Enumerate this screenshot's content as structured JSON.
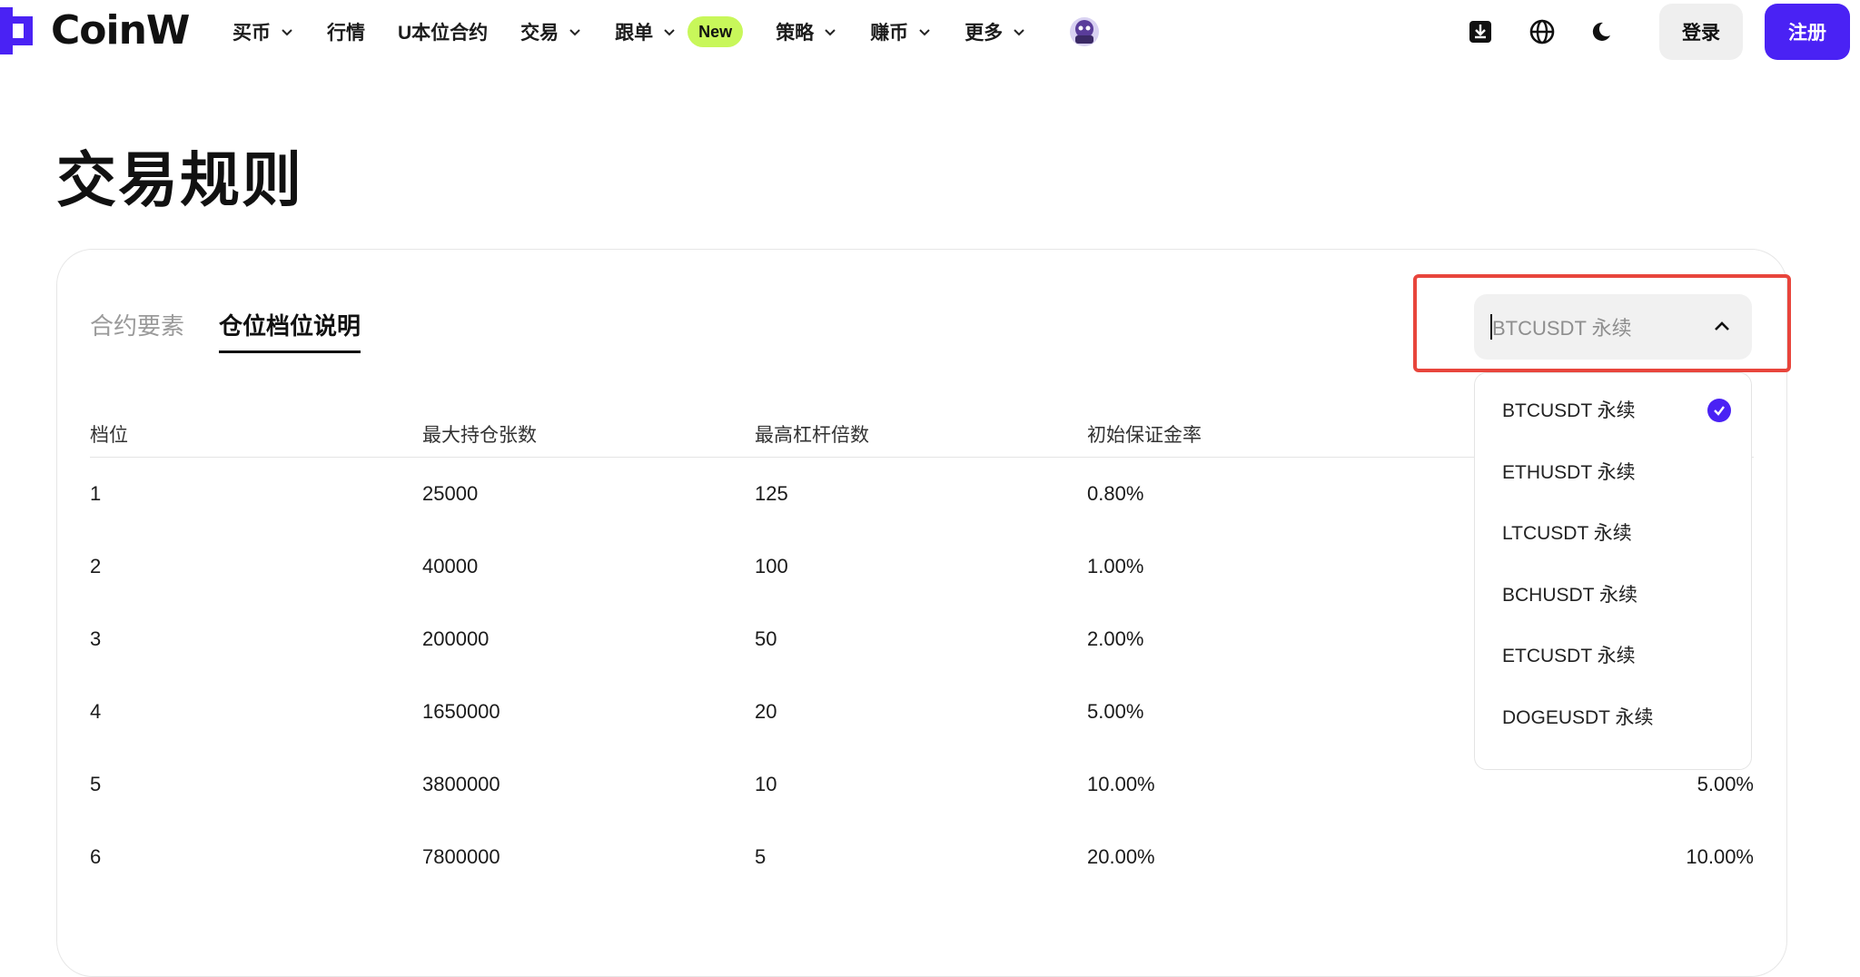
{
  "header": {
    "brand": "CoinW",
    "nav": [
      {
        "label": "买币",
        "dropdown": true
      },
      {
        "label": "行情",
        "dropdown": false
      },
      {
        "label": "U本位合约",
        "dropdown": false
      },
      {
        "label": "交易",
        "dropdown": true
      },
      {
        "label": "跟单",
        "dropdown": true,
        "badge": "New"
      },
      {
        "label": "策略",
        "dropdown": true
      },
      {
        "label": "赚币",
        "dropdown": true
      },
      {
        "label": "更多",
        "dropdown": true
      }
    ],
    "login_label": "登录",
    "register_label": "注册",
    "colors": {
      "accent": "#4a22f4",
      "badge": "#c8f75a",
      "highlight": "#e8453c"
    }
  },
  "page": {
    "title": "交易规则",
    "tabs": [
      {
        "label": "合约要素",
        "active": false
      },
      {
        "label": "仓位档位说明",
        "active": true
      }
    ]
  },
  "table": {
    "headers": [
      "档位",
      "最大持仓张数",
      "最高杠杆倍数",
      "初始保证金率",
      ""
    ],
    "rows": [
      [
        "1",
        "25000",
        "125",
        "0.80%",
        ""
      ],
      [
        "2",
        "40000",
        "100",
        "1.00%",
        ""
      ],
      [
        "3",
        "200000",
        "50",
        "2.00%",
        ""
      ],
      [
        "4",
        "1650000",
        "20",
        "5.00%",
        ""
      ],
      [
        "5",
        "3800000",
        "10",
        "10.00%",
        "5.00%"
      ],
      [
        "6",
        "7800000",
        "5",
        "20.00%",
        "10.00%"
      ]
    ]
  },
  "symbol_select": {
    "value": "BTCUSDT 永续",
    "options": [
      {
        "label": "BTCUSDT 永续",
        "selected": true
      },
      {
        "label": "ETHUSDT 永续",
        "selected": false
      },
      {
        "label": "LTCUSDT 永续",
        "selected": false
      },
      {
        "label": "BCHUSDT 永续",
        "selected": false
      },
      {
        "label": "ETCUSDT 永续",
        "selected": false
      },
      {
        "label": "DOGEUSDT 永续",
        "selected": false
      }
    ]
  }
}
